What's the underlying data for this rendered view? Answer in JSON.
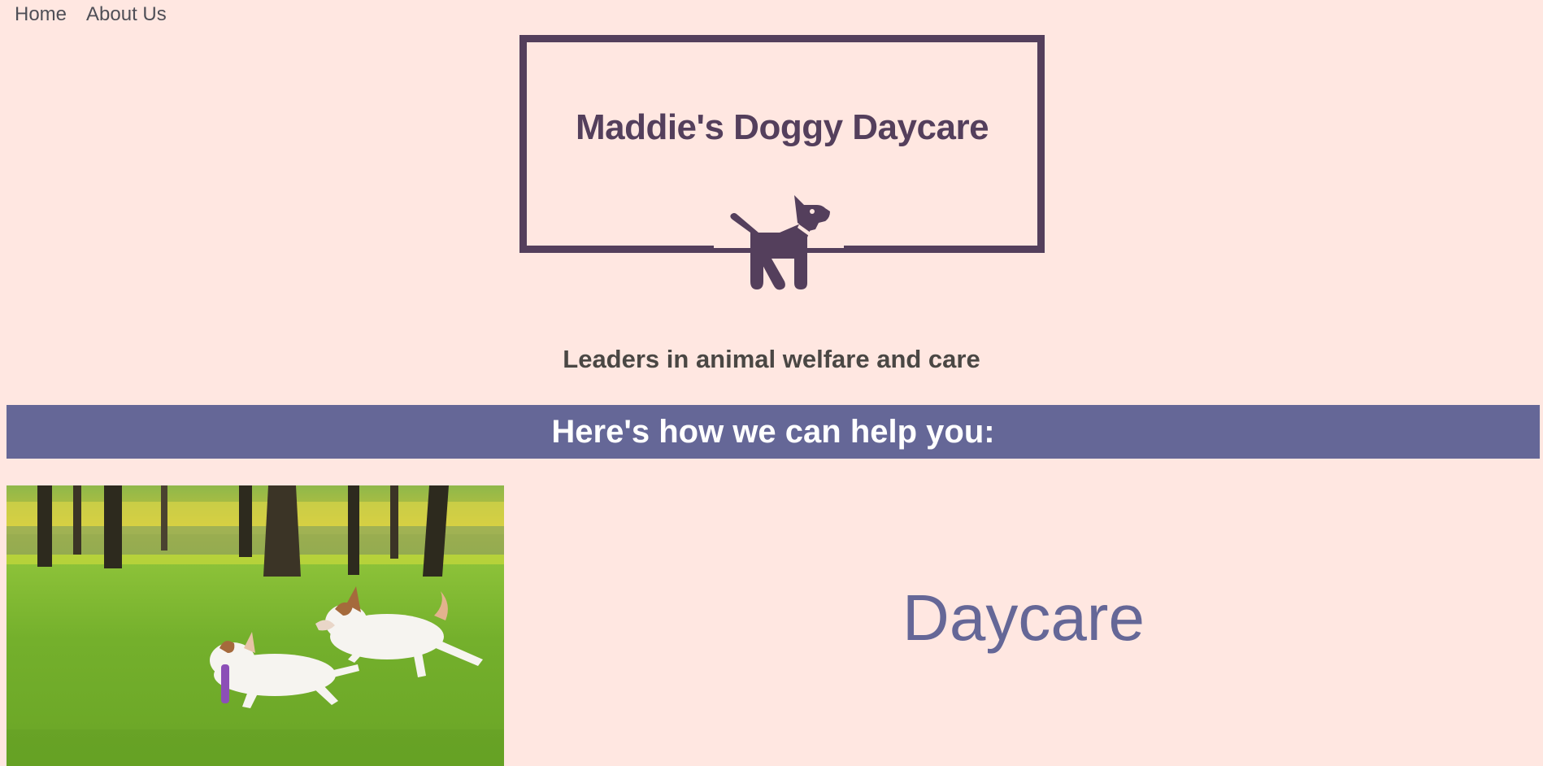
{
  "nav": {
    "items": [
      {
        "label": "Home"
      },
      {
        "label": "About Us"
      }
    ]
  },
  "logo": {
    "title": "Maddie's Doggy Daycare",
    "icon": "dog-icon"
  },
  "tagline": "Leaders in animal welfare and care",
  "banner": {
    "heading": "Here's how we can help you:"
  },
  "services": [
    {
      "title": "Daycare",
      "image": "two-dogs-running-in-park"
    }
  ],
  "colors": {
    "background": "#ffe7e1",
    "brand": "#543f5c",
    "accent": "#656797",
    "text": "#4a4744"
  }
}
